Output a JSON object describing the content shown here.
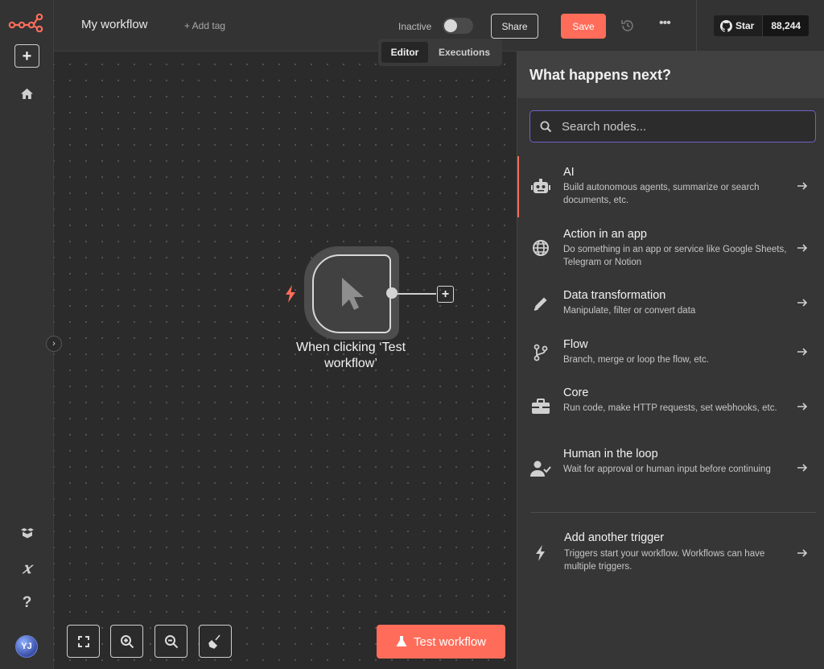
{
  "header": {
    "workflow_name": "My workflow",
    "add_tag": "+ Add tag",
    "status_label": "Inactive",
    "share_label": "Share",
    "save_label": "Save",
    "more_label": "•••",
    "github": {
      "star_label": "Star",
      "star_count": "88,244"
    }
  },
  "tabs": [
    {
      "label": "Editor",
      "active": true
    },
    {
      "label": "Executions",
      "active": false
    }
  ],
  "canvas": {
    "node_label": "When clicking ‘Test workflow’",
    "test_button_label": "Test workflow"
  },
  "sidebar": {
    "user_initials": "YJ"
  },
  "panel": {
    "title": "What happens next?",
    "search_placeholder": "Search nodes...",
    "categories": [
      {
        "title": "AI",
        "description": "Build autonomous agents, summarize or search documents, etc.",
        "icon": "robot-icon",
        "selected": true
      },
      {
        "title": "Action in an app",
        "description": "Do something in an app or service like Google Sheets, Telegram or Notion",
        "icon": "globe-icon",
        "selected": false
      },
      {
        "title": "Data transformation",
        "description": "Manipulate, filter or convert data",
        "icon": "pen-icon",
        "selected": false
      },
      {
        "title": "Flow",
        "description": "Branch, merge or loop the flow, etc.",
        "icon": "branch-icon",
        "selected": false
      },
      {
        "title": "Core",
        "description": "Run code, make HTTP requests, set webhooks, etc.",
        "icon": "toolbox-icon",
        "selected": false
      },
      {
        "title": "Human in the loop",
        "description": "Wait for approval or human input before continuing",
        "icon": "user-check-icon",
        "selected": false
      }
    ],
    "trigger": {
      "title": "Add another trigger",
      "description": "Triggers start your workflow. Workflows can have multiple triggers.",
      "icon": "bolt-icon"
    }
  },
  "colors": {
    "accent": "#ff6d5a",
    "search_border": "#6f63c9"
  }
}
